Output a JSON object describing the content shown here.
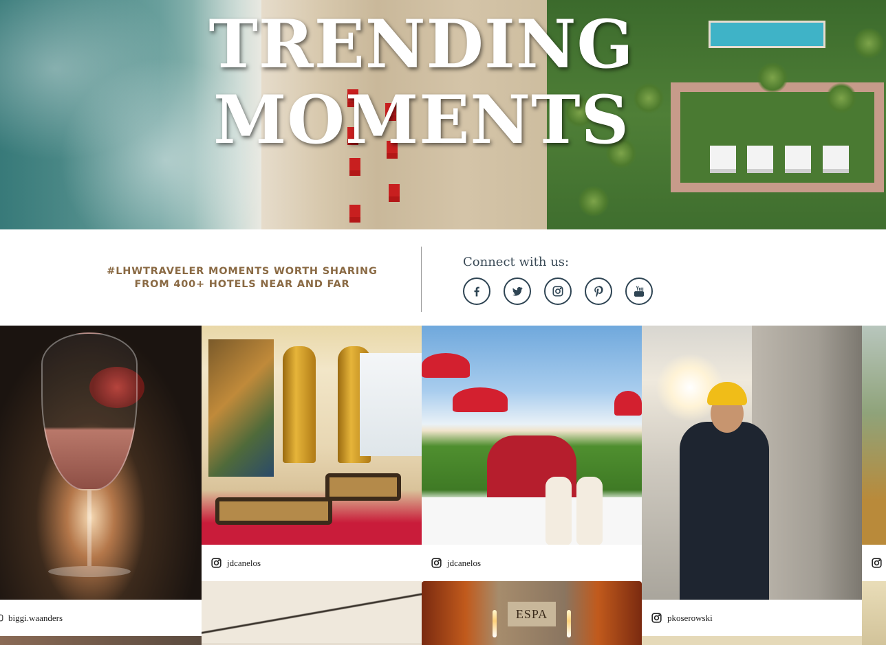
{
  "hero": {
    "title": "TRENDING MOMENTS"
  },
  "strip": {
    "tagline_line1": "#LHWTRAVELER MOMENTS WORTH SHARING",
    "tagline_line2": "FROM 400+ HOTELS NEAR AND FAR",
    "connect_label": "Connect with us:",
    "socials": [
      {
        "icon": "facebook-icon"
      },
      {
        "icon": "twitter-icon"
      },
      {
        "icon": "instagram-icon"
      },
      {
        "icon": "pinterest-icon"
      },
      {
        "icon": "youtube-icon"
      }
    ],
    "colors": {
      "tagline": "#8a6a44",
      "icon": "#2e4453"
    }
  },
  "grid": {
    "posts": [
      {
        "user": "biggi.waanders",
        "icon": "instagram-icon"
      },
      {
        "user": "jdcanelos",
        "icon": "instagram-icon"
      },
      {
        "user": "jdcanelos",
        "icon": "instagram-icon"
      },
      {
        "user": "pkoserowski",
        "icon": "instagram-icon"
      },
      {
        "user": "",
        "icon": "instagram-icon"
      }
    ],
    "spa_sign": "ESPA"
  }
}
